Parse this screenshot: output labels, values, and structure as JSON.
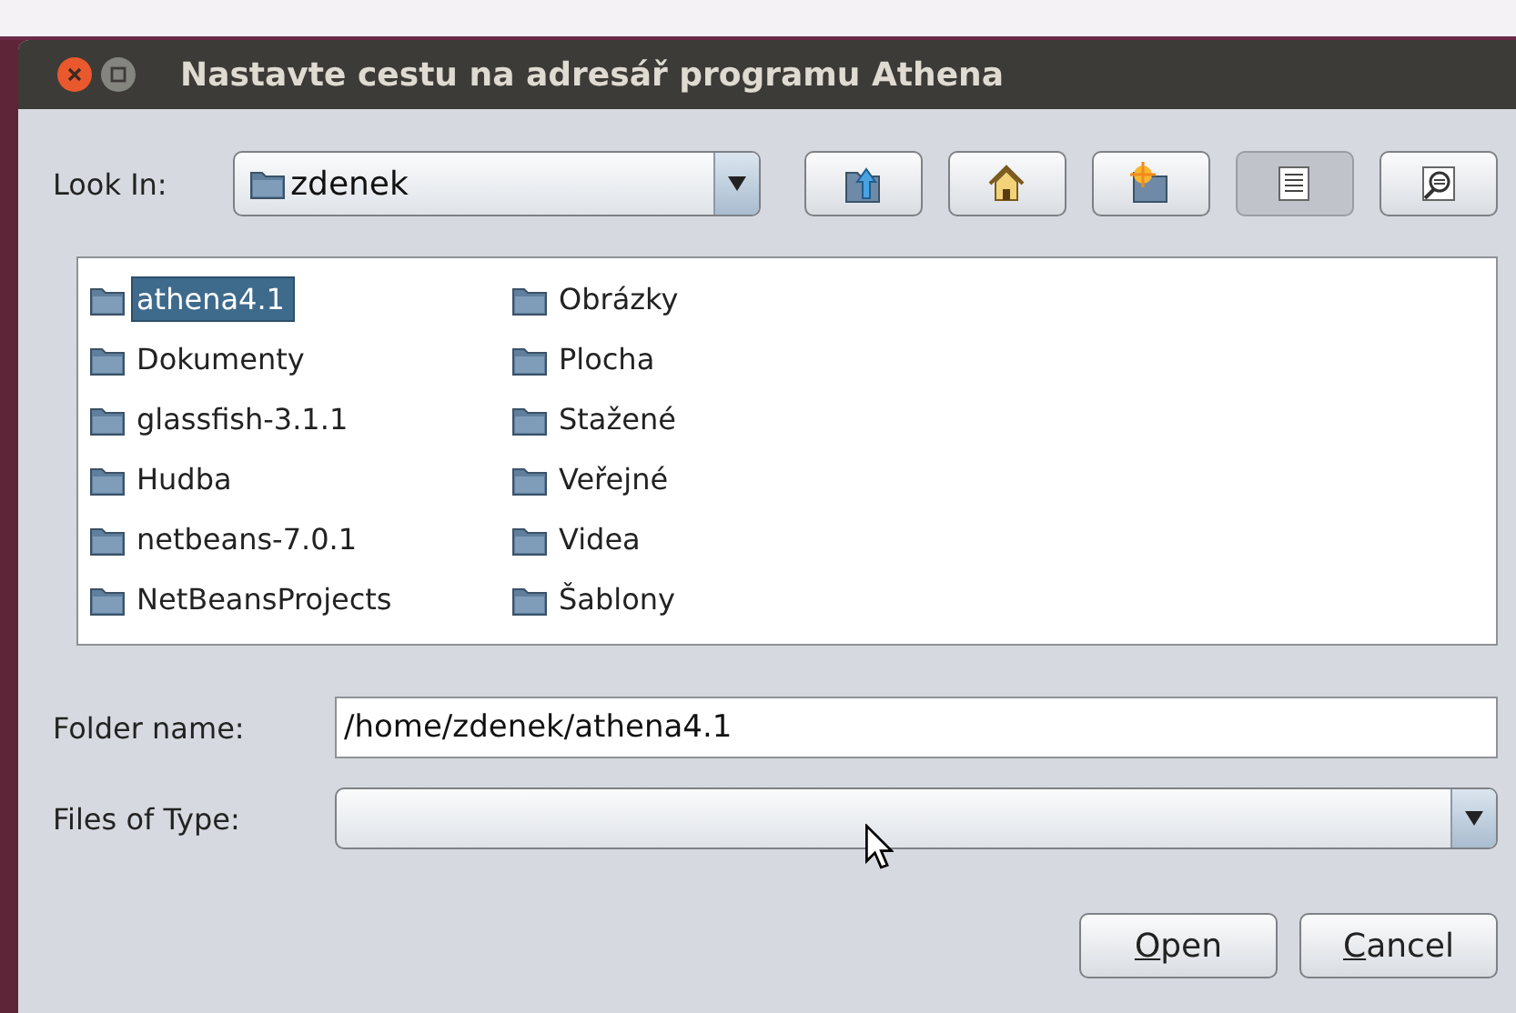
{
  "window": {
    "title": "Nastavte cestu na adresář programu Athena",
    "buttons": [
      {
        "kind": "close"
      },
      {
        "kind": "maximize"
      }
    ]
  },
  "look_in": {
    "label": "Look In:",
    "value": "zdenek"
  },
  "toolbar": [
    {
      "kind": "up",
      "pressed": false
    },
    {
      "kind": "home",
      "pressed": false
    },
    {
      "kind": "new-folder",
      "pressed": false
    },
    {
      "kind": "list",
      "pressed": true
    },
    {
      "kind": "details",
      "pressed": false
    }
  ],
  "files": [
    {
      "name": "athena4.1",
      "selected": true
    },
    {
      "name": "Dokumenty",
      "selected": false
    },
    {
      "name": "glassfish-3.1.1",
      "selected": false
    },
    {
      "name": "Hudba",
      "selected": false
    },
    {
      "name": "netbeans-7.0.1",
      "selected": false
    },
    {
      "name": "NetBeansProjects",
      "selected": false
    },
    {
      "name": "Obrázky",
      "selected": false
    },
    {
      "name": "Plocha",
      "selected": false
    },
    {
      "name": "Stažené",
      "selected": false
    },
    {
      "name": "Veřejné",
      "selected": false
    },
    {
      "name": "Videa",
      "selected": false
    },
    {
      "name": "Šablony",
      "selected": false
    }
  ],
  "folder_name": {
    "label": "Folder name:",
    "value": "/home/zdenek/athena4.1"
  },
  "files_of_type": {
    "label": "Files of Type:"
  },
  "buttons": [
    {
      "label": "Open",
      "underline_first": true
    },
    {
      "label": "Cancel",
      "underline_first": true
    }
  ]
}
